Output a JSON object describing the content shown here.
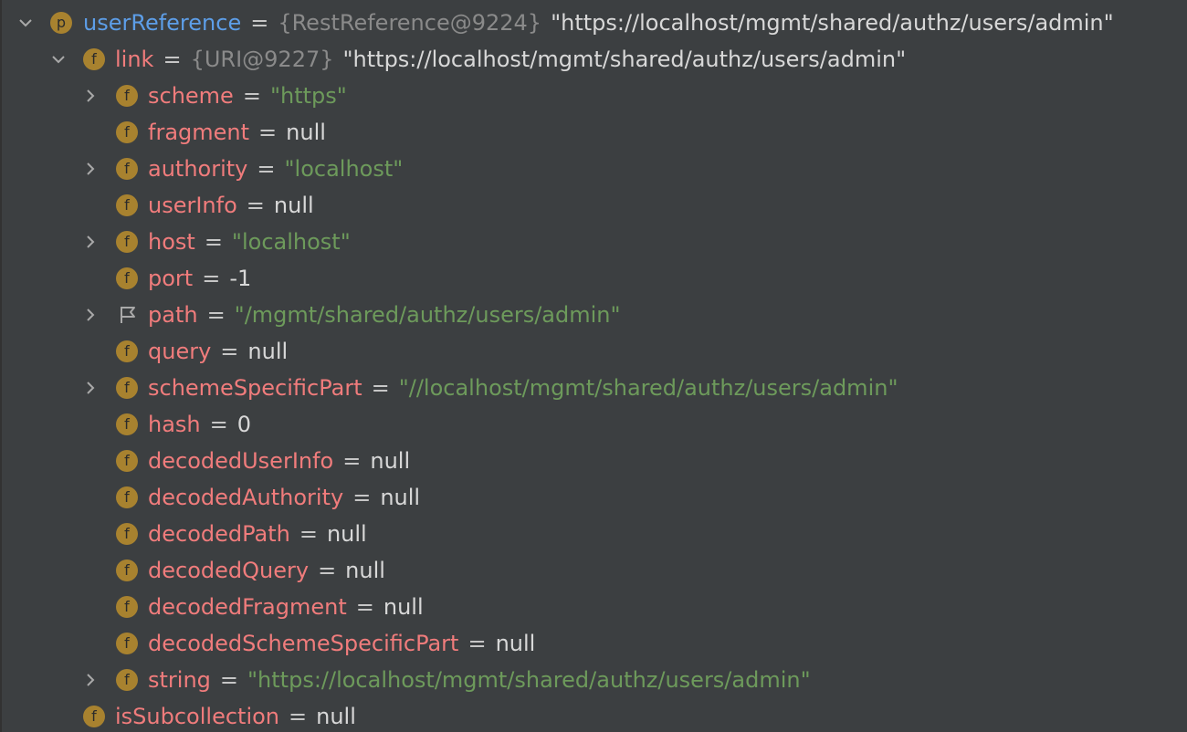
{
  "rows": [
    {
      "name": "userReference",
      "icon": "p",
      "ref": "{RestReference@9224}",
      "value": "\"https://localhost/mgmt/shared/authz/users/admin\""
    },
    {
      "name": "link",
      "icon": "f",
      "ref": "{URI@9227}",
      "value": "\"https://localhost/mgmt/shared/authz/users/admin\""
    },
    {
      "name": "scheme",
      "icon": "f",
      "value": "\"https\""
    },
    {
      "name": "fragment",
      "icon": "f",
      "value": "null"
    },
    {
      "name": "authority",
      "icon": "f",
      "value": "\"localhost\""
    },
    {
      "name": "userInfo",
      "icon": "f",
      "value": "null"
    },
    {
      "name": "host",
      "icon": "f",
      "value": "\"localhost\""
    },
    {
      "name": "port",
      "icon": "f",
      "value": "-1"
    },
    {
      "name": "path",
      "icon": "flag",
      "value": "\"/mgmt/shared/authz/users/admin\""
    },
    {
      "name": "query",
      "icon": "f",
      "value": "null"
    },
    {
      "name": "schemeSpecificPart",
      "icon": "f",
      "value": "\"//localhost/mgmt/shared/authz/users/admin\""
    },
    {
      "name": "hash",
      "icon": "f",
      "value": "0"
    },
    {
      "name": "decodedUserInfo",
      "icon": "f",
      "value": "null"
    },
    {
      "name": "decodedAuthority",
      "icon": "f",
      "value": "null"
    },
    {
      "name": "decodedPath",
      "icon": "f",
      "value": "null"
    },
    {
      "name": "decodedQuery",
      "icon": "f",
      "value": "null"
    },
    {
      "name": "decodedFragment",
      "icon": "f",
      "value": "null"
    },
    {
      "name": "decodedSchemeSpecificPart",
      "icon": "f",
      "value": "null"
    },
    {
      "name": "string",
      "icon": "f",
      "value": "\"https://localhost/mgmt/shared/authz/users/admin\""
    },
    {
      "name": "isSubcollection",
      "icon": "f",
      "value": "null"
    }
  ],
  "equals": "=",
  "colors": {
    "background": "#3c3f41",
    "field_name": "#f07c7c",
    "root_name": "#5d9ee8",
    "string_value": "#6d9a5b",
    "reference": "#8a8a8a",
    "plain_value": "#d8d8d8",
    "icon_badge": "#a8822f"
  }
}
